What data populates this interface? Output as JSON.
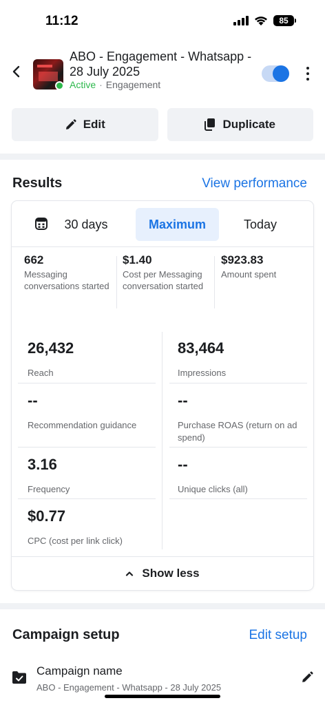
{
  "status_bar": {
    "time": "11:12",
    "battery": "85"
  },
  "header": {
    "title": "ABO - Engagement - Whatsapp - 28 July 2025",
    "status": "Active",
    "separator": "·",
    "objective": "Engagement",
    "toggle_on": true
  },
  "actions": {
    "edit_label": "Edit",
    "duplicate_label": "Duplicate"
  },
  "results": {
    "title": "Results",
    "link": "View performance",
    "ranges": [
      "30 days",
      "Maximum",
      "Today"
    ],
    "selected_range": "Maximum",
    "top_metrics": [
      {
        "value": "662",
        "label": "Messaging conversations started"
      },
      {
        "value": "$1.40",
        "label": "Cost per Messaging conversation started"
      },
      {
        "value": "$923.83",
        "label": "Amount spent"
      }
    ],
    "left_metrics": [
      {
        "value": "26,432",
        "label": "Reach"
      },
      {
        "value": "--",
        "label": "Recommendation guidance"
      },
      {
        "value": "3.16",
        "label": "Frequency"
      },
      {
        "value": "$0.77",
        "label": "CPC (cost per link click)"
      }
    ],
    "right_metrics": [
      {
        "value": "83,464",
        "label": "Impressions"
      },
      {
        "value": "--",
        "label": "Purchase ROAS (return on ad spend)"
      },
      {
        "value": "--",
        "label": "Unique clicks (all)"
      }
    ],
    "show_less": "Show less"
  },
  "campaign_setup": {
    "title": "Campaign setup",
    "link": "Edit setup",
    "name_label": "Campaign name",
    "name_value": "ABO - Engagement - Whatsapp - 28 July 2025"
  },
  "colors": {
    "accent": "#1b74e4",
    "active": "#2db84c",
    "selected_bg": "#e7f0fd"
  },
  "icons": [
    "chevron-left-icon",
    "more-vertical-icon",
    "pencil-icon",
    "copy-icon",
    "calendar-icon",
    "chevron-up-icon",
    "folder-check-icon"
  ]
}
